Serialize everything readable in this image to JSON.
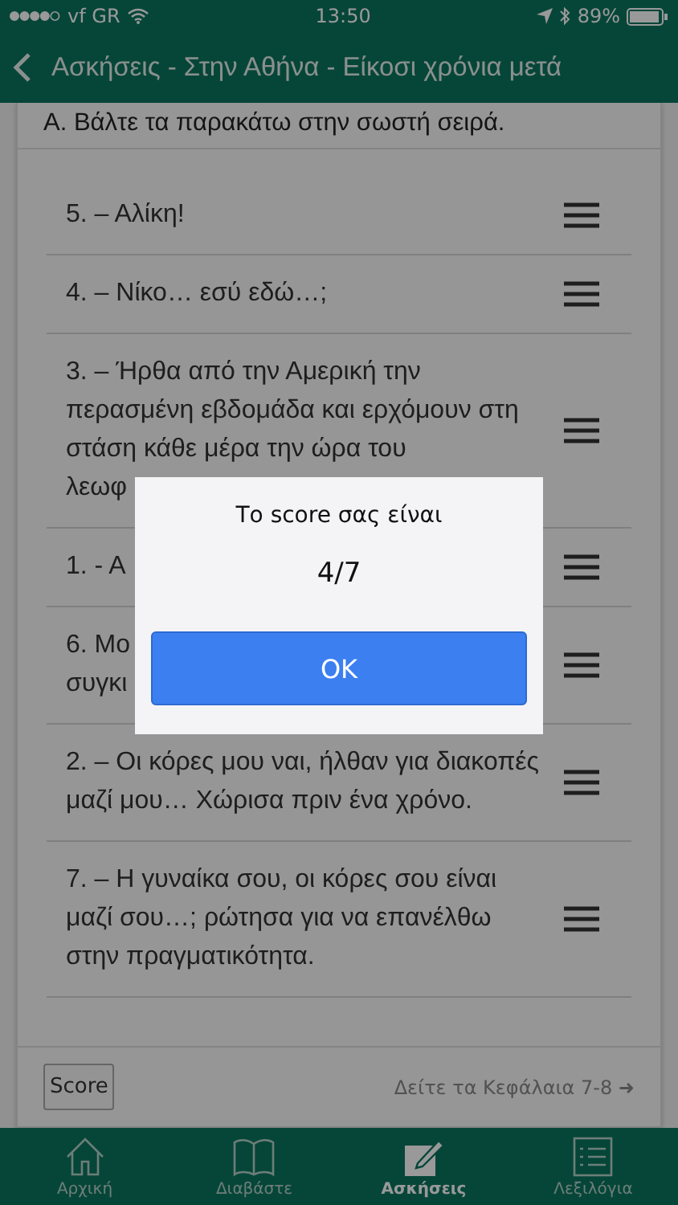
{
  "status_bar": {
    "carrier": "vf GR",
    "time": "13:50",
    "battery": "89%"
  },
  "nav_bar": {
    "title": "Ασκήσεις - Στην Αθήνα - Είκοσι χρόνια μετά"
  },
  "exercise": {
    "instruction": "Α. Βάλτε τα παρακάτω στην σωστή σειρά.",
    "items": [
      {
        "text": "5. – Αλίκη!"
      },
      {
        "text": "4. – Νίκο… εσύ εδώ…;"
      },
      {
        "text": "3. – Ήρθα από την Αμερική την περασμένη εβδομάδα και ερχόμουν στη στάση κάθε μέρα την ώρα του\nλεωφ"
      },
      {
        "text": "1. - Α"
      },
      {
        "text": "6. Μο\nσυγκι"
      },
      {
        "text": "2. – Οι κόρες μου ναι, ήλθαν για διακοπές μαζί μου… Χώρισα πριν ένα χρόνο."
      },
      {
        "text": "7. – Η γυναίκα σου, οι κόρες σου είναι μαζί σου…; ρώτησα για να επανέλθω στην πραγματικότητα."
      }
    ],
    "score_button": "Score",
    "next_link": "Δείτε τα Κεφάλαια 7-8 ➜"
  },
  "tab_bar": [
    {
      "label": "Αρχική",
      "selected": false
    },
    {
      "label": "Διαβάστε",
      "selected": false
    },
    {
      "label": "Ασκήσεις",
      "selected": true
    },
    {
      "label": "Λεξιλόγια",
      "selected": false
    }
  ],
  "dialog": {
    "title": "Το score σας είναι",
    "value": "4/7",
    "button": "OK"
  }
}
